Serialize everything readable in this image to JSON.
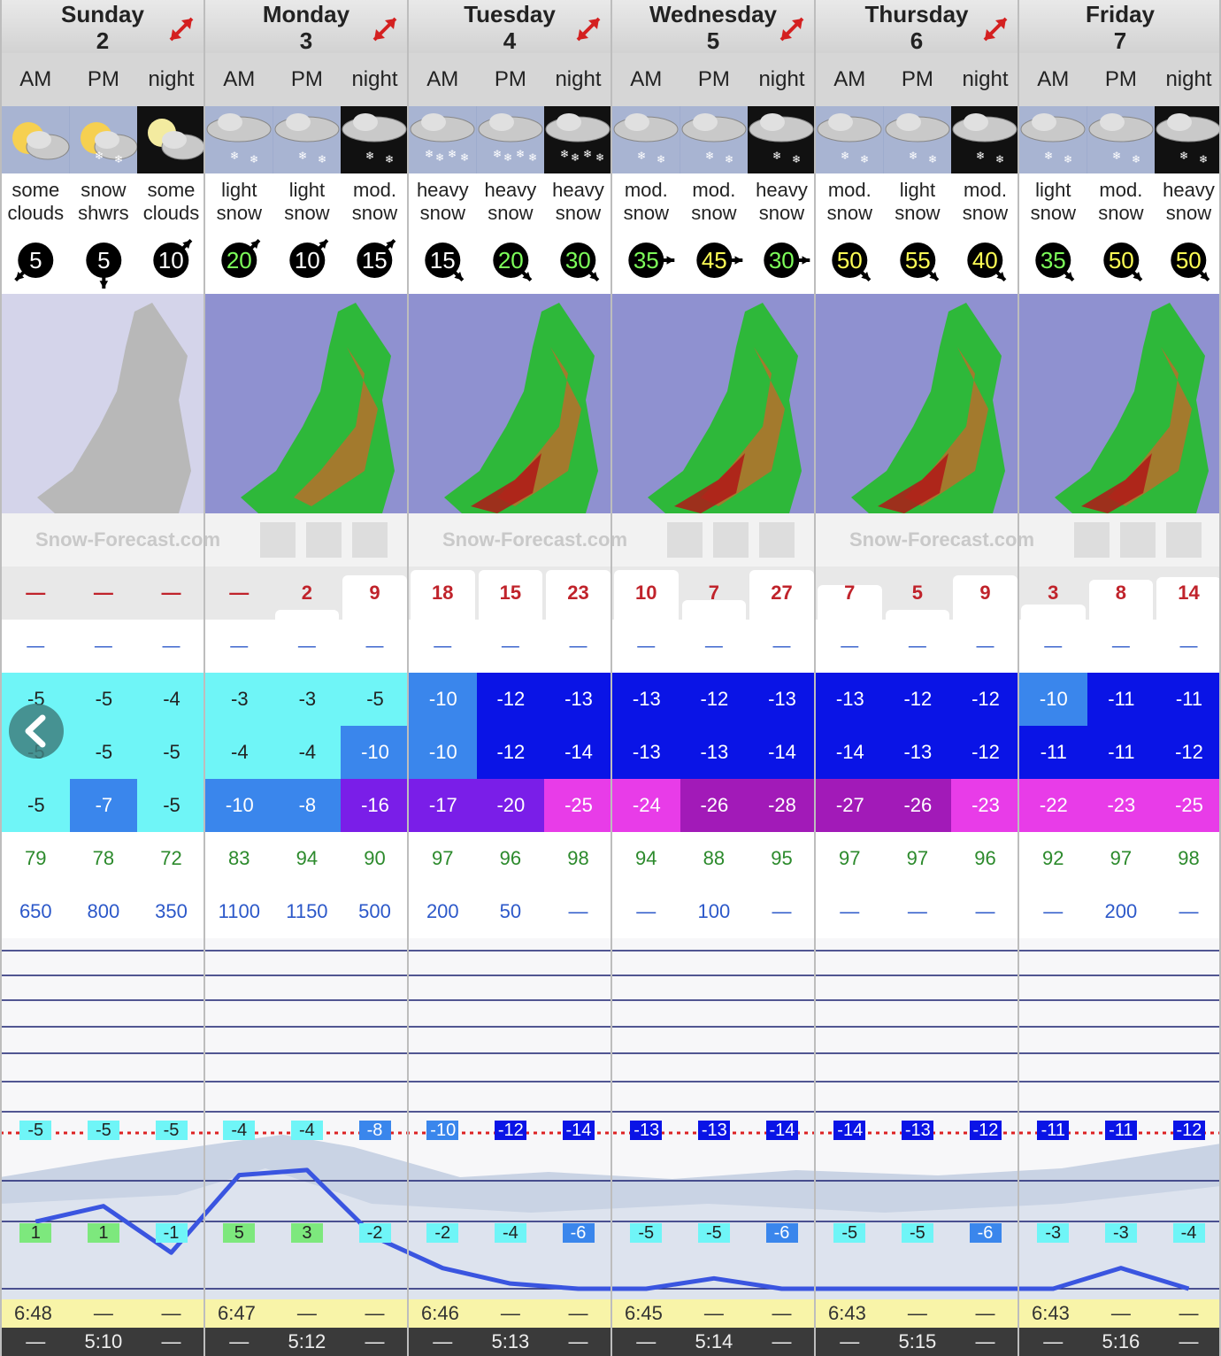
{
  "days": [
    {
      "name": "Sunday",
      "num": "2"
    },
    {
      "name": "Monday",
      "num": "3"
    },
    {
      "name": "Tuesday",
      "num": "4"
    },
    {
      "name": "Wednesday",
      "num": "5"
    },
    {
      "name": "Thursday",
      "num": "6"
    },
    {
      "name": "Friday",
      "num": "7"
    }
  ],
  "periods": [
    "AM",
    "PM",
    "night"
  ],
  "weather_icons": [
    "sun-cloud",
    "sun-cloud-snow",
    "moon-cloud",
    "cloud-snow",
    "cloud-snow",
    "cloud-snow-night",
    "cloud-heavy-snow",
    "cloud-heavy-snow",
    "cloud-heavy-snow-night",
    "cloud-snow",
    "cloud-snow",
    "cloud-snow-night",
    "cloud-snow",
    "cloud-snow",
    "cloud-snow-night",
    "cloud-snow",
    "cloud-snow",
    "cloud-snow-night"
  ],
  "weather_text": [
    [
      "some",
      "clouds"
    ],
    [
      "snow",
      "shwrs"
    ],
    [
      "some",
      "clouds"
    ],
    [
      "light",
      "snow"
    ],
    [
      "light",
      "snow"
    ],
    [
      "mod.",
      "snow"
    ],
    [
      "heavy",
      "snow"
    ],
    [
      "heavy",
      "snow"
    ],
    [
      "heavy",
      "snow"
    ],
    [
      "mod.",
      "snow"
    ],
    [
      "mod.",
      "snow"
    ],
    [
      "heavy",
      "snow"
    ],
    [
      "mod.",
      "snow"
    ],
    [
      "light",
      "snow"
    ],
    [
      "mod.",
      "snow"
    ],
    [
      "light",
      "snow"
    ],
    [
      "mod.",
      "snow"
    ],
    [
      "heavy",
      "snow"
    ]
  ],
  "wind": [
    {
      "speed": "5",
      "color": "#ffffff",
      "dir": "sw"
    },
    {
      "speed": "5",
      "color": "#ffffff",
      "dir": "s"
    },
    {
      "speed": "10",
      "color": "#ffffff",
      "dir": "ne"
    },
    {
      "speed": "20",
      "color": "#7dff5a",
      "dir": "ne"
    },
    {
      "speed": "10",
      "color": "#ffffff",
      "dir": "ne"
    },
    {
      "speed": "15",
      "color": "#ffffff",
      "dir": "ne"
    },
    {
      "speed": "15",
      "color": "#ffffff",
      "dir": "se"
    },
    {
      "speed": "20",
      "color": "#7dff5a",
      "dir": "se"
    },
    {
      "speed": "30",
      "color": "#7dff5a",
      "dir": "se"
    },
    {
      "speed": "35",
      "color": "#7dff5a",
      "dir": "e"
    },
    {
      "speed": "45",
      "color": "#ffff55",
      "dir": "e"
    },
    {
      "speed": "30",
      "color": "#7dff5a",
      "dir": "e"
    },
    {
      "speed": "50",
      "color": "#ffff55",
      "dir": "se"
    },
    {
      "speed": "55",
      "color": "#ffff55",
      "dir": "se"
    },
    {
      "speed": "40",
      "color": "#ffff55",
      "dir": "se"
    },
    {
      "speed": "35",
      "color": "#7dff5a",
      "dir": "se"
    },
    {
      "speed": "50",
      "color": "#ffff55",
      "dir": "se"
    },
    {
      "speed": "50",
      "color": "#ffff55",
      "dir": "se"
    }
  ],
  "brand": "Snow-Forecast.com",
  "snow": [
    "—",
    "—",
    "—",
    "—",
    "2",
    "9",
    "18",
    "15",
    "23",
    "10",
    "7",
    "27",
    "7",
    "5",
    "9",
    "3",
    "8",
    "14"
  ],
  "snow_fill": [
    0,
    0,
    0,
    0,
    0.2,
    0.9,
    1,
    1,
    1,
    1,
    0.4,
    1,
    0.7,
    0.2,
    0.9,
    0.3,
    0.8,
    0.85
  ],
  "rain": [
    "—",
    "—",
    "—",
    "—",
    "—",
    "—",
    "—",
    "—",
    "—",
    "—",
    "—",
    "—",
    "—",
    "—",
    "—",
    "—",
    "—",
    "—"
  ],
  "temp_max": [
    "-5",
    "-5",
    "-4",
    "-3",
    "-3",
    "-5",
    "-10",
    "-12",
    "-13",
    "-13",
    "-12",
    "-13",
    "-13",
    "-12",
    "-12",
    "-10",
    "-11",
    "-11"
  ],
  "temp_min": [
    "-5",
    "-5",
    "-5",
    "-4",
    "-4",
    "-10",
    "-10",
    "-12",
    "-14",
    "-13",
    "-13",
    "-14",
    "-14",
    "-13",
    "-12",
    "-11",
    "-11",
    "-12"
  ],
  "windchill": [
    "-5",
    "-7",
    "-5",
    "-10",
    "-8",
    "-16",
    "-17",
    "-20",
    "-25",
    "-24",
    "-26",
    "-28",
    "-27",
    "-26",
    "-23",
    "-22",
    "-23",
    "-25"
  ],
  "humidity": [
    "79",
    "78",
    "72",
    "83",
    "94",
    "90",
    "97",
    "96",
    "98",
    "94",
    "88",
    "95",
    "97",
    "97",
    "96",
    "92",
    "97",
    "98"
  ],
  "freezing_level": [
    "650",
    "800",
    "350",
    "1100",
    "1150",
    "500",
    "200",
    "50",
    "—",
    "—",
    "100",
    "—",
    "—",
    "—",
    "—",
    "—",
    "200",
    "—"
  ],
  "peak_temps": [
    "-5",
    "-5",
    "-5",
    "-4",
    "-4",
    "-8",
    "-10",
    "-12",
    "-14",
    "-13",
    "-13",
    "-14",
    "-14",
    "-13",
    "-12",
    "-11",
    "-11",
    "-12"
  ],
  "base_temps": [
    "1",
    "1",
    "-1",
    "5",
    "3",
    "-2",
    "-2",
    "-4",
    "-6",
    "-5",
    "-5",
    "-6",
    "-5",
    "-5",
    "-6",
    "-3",
    "-3",
    "-4"
  ],
  "sunrise": [
    "6:48",
    "—",
    "—",
    "6:47",
    "—",
    "—",
    "6:46",
    "—",
    "—",
    "6:45",
    "—",
    "—",
    "6:43",
    "—",
    "—",
    "6:43",
    "—",
    "—"
  ],
  "sunset": [
    "—",
    "5:10",
    "—",
    "—",
    "5:12",
    "—",
    "—",
    "5:13",
    "—",
    "—",
    "5:14",
    "—",
    "—",
    "5:15",
    "—",
    "—",
    "5:16",
    "—"
  ],
  "colors": {
    "cyan": "#6ff5f7",
    "mid_blue": "#3a86ec",
    "blue": "#0a14e6",
    "violet": "#7a1ee8",
    "magenta": "#e83ce8",
    "purple": "#a21ab8",
    "green": "#7de87d"
  }
}
